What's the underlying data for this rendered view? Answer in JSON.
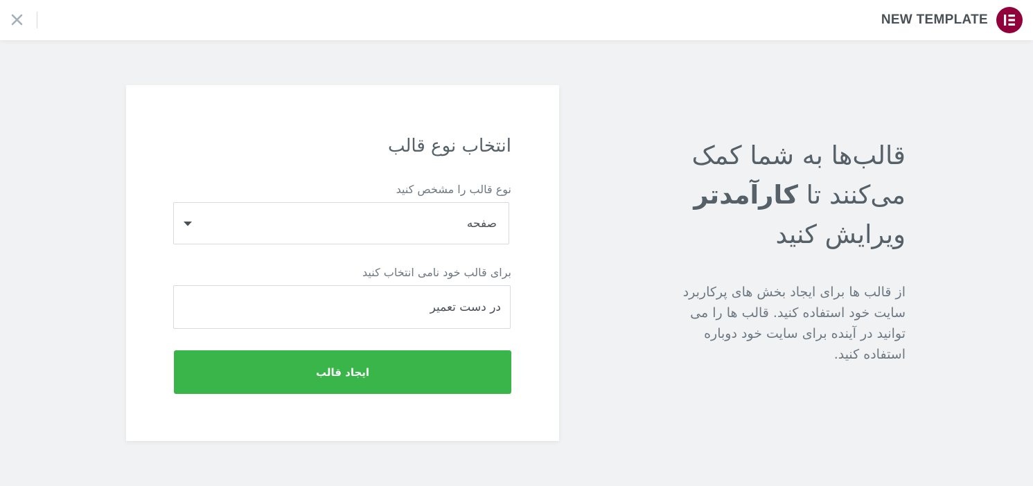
{
  "header": {
    "title": "NEW TEMPLATE",
    "logo_icon": "elementor-logo-icon",
    "close_icon": "close-icon"
  },
  "intro": {
    "heading_before": "قالب‌ها به شما کمک می‌کنند تا ",
    "heading_strong": "کارآمدتر",
    "heading_after": " ویرایش کنید",
    "description": "از قالب ها برای ایجاد بخش های پرکاربرد سایت خود استفاده کنید. قالب ها را می توانید در آینده برای سایت خود دوباره استفاده کنید."
  },
  "form": {
    "title": "انتخاب نوع قالب",
    "type_label": "نوع قالب را مشخص کنید",
    "type_selected": "صفحه",
    "name_label": "برای قالب خود نامی انتخاب کنید",
    "name_value": "در دست تعمیر",
    "submit_label": "ایجاد قالب"
  },
  "colors": {
    "brand": "#92003b",
    "primary_button": "#39b54a",
    "background": "#f1f2f3"
  }
}
